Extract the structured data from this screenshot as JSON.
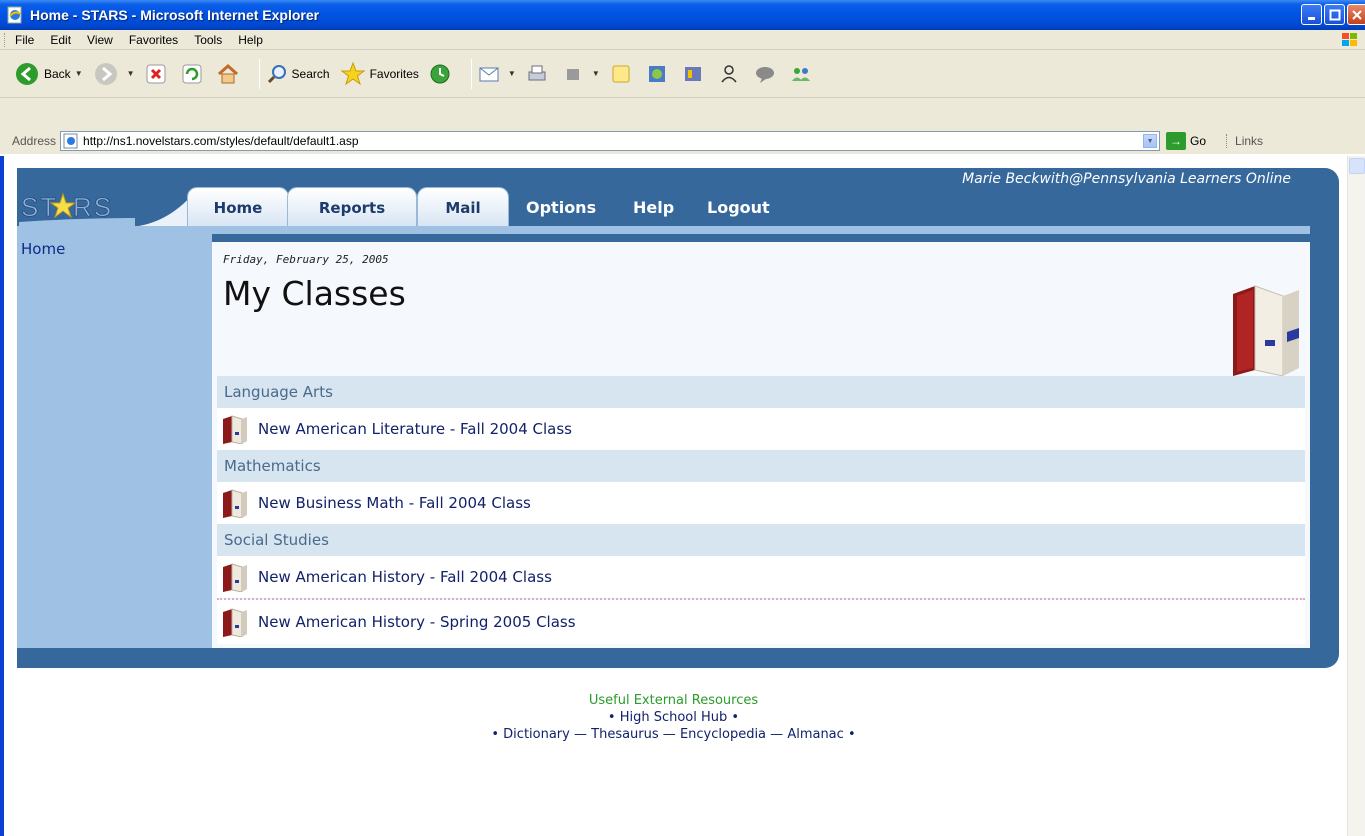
{
  "window": {
    "title": "Home - STARS - Microsoft Internet Explorer"
  },
  "menu": {
    "items": [
      "File",
      "Edit",
      "View",
      "Favorites",
      "Tools",
      "Help"
    ]
  },
  "toolbar": {
    "back_label": "Back",
    "search_label": "Search",
    "favorites_label": "Favorites"
  },
  "address": {
    "label": "Address",
    "url": "http://ns1.novelstars.com/styles/default/default1.asp",
    "go_label": "Go",
    "links_label": "Links"
  },
  "stars": {
    "logo_text": "STARS",
    "user_info": "Marie Beckwith@Pennsylvania Learners Online",
    "tabs": [
      "Home",
      "Reports",
      "Mail"
    ],
    "nav_links": [
      "Options",
      "Help",
      "Logout"
    ],
    "sidebar_link": "Home"
  },
  "main": {
    "date": "Friday, February 25, 2005",
    "heading": "My Classes",
    "categories": [
      {
        "name": "Language Arts",
        "classes": [
          "New American Literature - Fall 2004 Class"
        ]
      },
      {
        "name": "Mathematics",
        "classes": [
          "New Business Math - Fall 2004 Class"
        ]
      },
      {
        "name": "Social Studies",
        "classes": [
          "New American History - Fall 2004 Class",
          "New American History - Spring 2005 Class"
        ]
      }
    ]
  },
  "resources": {
    "title": "Useful External Resources",
    "hub": "High School Hub",
    "links": [
      "Dictionary",
      "Thesaurus",
      "Encyclopedia",
      "Almanac"
    ],
    "bullet": "•",
    "dash": "—"
  }
}
